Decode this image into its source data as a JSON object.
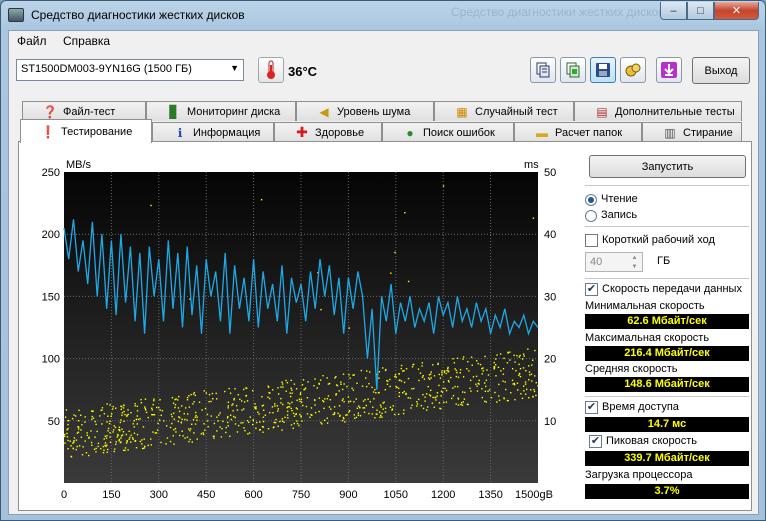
{
  "window": {
    "title": "Средство диагностики жестких дисков",
    "ghost_title": "Средство диагностики жестких дисков",
    "minimize": "–",
    "maximize": "□",
    "close": "✕"
  },
  "menu": {
    "file": "Файл",
    "help": "Справка"
  },
  "toolbar": {
    "drive": "ST1500DM003-9YN16G (1500 ГБ)",
    "temperature": "36°C",
    "exit": "Выход",
    "icons": [
      "copy-icon",
      "copy-text-icon",
      "save-icon",
      "screenshot-icon",
      "download-icon"
    ]
  },
  "tabs_row1": [
    {
      "label": "Файл-тест",
      "icon": "file-test-icon",
      "glyph": "❓"
    },
    {
      "label": "Мониторинг диска",
      "icon": "bar-chart-icon",
      "glyph": "▊"
    },
    {
      "label": "Уровень шума",
      "icon": "speaker-icon",
      "glyph": "🔊"
    },
    {
      "label": "Случайный тест",
      "icon": "random-icon",
      "glyph": "▦"
    },
    {
      "label": "Дополнительные тесты",
      "icon": "extra-tests-icon",
      "glyph": "▤"
    }
  ],
  "tabs_row2": [
    {
      "label": "Тестирование",
      "icon": "benchmark-icon",
      "glyph": "❗"
    },
    {
      "label": "Информация",
      "icon": "info-icon",
      "glyph": "ℹ"
    },
    {
      "label": "Здоровье",
      "icon": "health-cross-icon",
      "glyph": "✚"
    },
    {
      "label": "Поиск ошибок",
      "icon": "magnifier-icon",
      "glyph": "🔍"
    },
    {
      "label": "Расчет папок",
      "icon": "folder-icon",
      "glyph": "▬"
    },
    {
      "label": "Стирание",
      "icon": "trash-icon",
      "glyph": "🗑"
    }
  ],
  "controls": {
    "start": "Запустить",
    "read": "Чтение",
    "write": "Запись",
    "short_stroke": "Короткий рабочий ход",
    "short_stroke_value": "40",
    "short_stroke_unit": "ГБ",
    "transfer_rate": "Скорость передачи данных",
    "min_speed_label": "Минимальная скорость",
    "min_speed": "62.6 Мбайт/сек",
    "max_speed_label": "Максимальная скорость",
    "max_speed": "216.4 Мбайт/сек",
    "avg_speed_label": "Средняя скорость",
    "avg_speed": "148.6 Мбайт/сек",
    "access_time": "Время доступа",
    "access_time_value": "14.7 мс",
    "burst_rate": "Пиковая скорость",
    "burst_rate_value": "339.7 Мбайт/сек",
    "cpu_label": "Загрузка процессора",
    "cpu_value": "3.7%",
    "read_checked": true,
    "short_stroke_checked": false,
    "transfer_checked": true,
    "access_checked": true,
    "burst_checked": true
  },
  "chart_data": {
    "type": "line",
    "ylabel_left": "MB/s",
    "ylabel_right": "ms",
    "x_unit": "gB",
    "x_ticks": [
      "0",
      "150",
      "300",
      "450",
      "600",
      "750",
      "900",
      "1050",
      "1200",
      "1350",
      "1500gB"
    ],
    "y_left_ticks": [
      "250",
      "200",
      "150",
      "100",
      "50"
    ],
    "y_right_ticks": [
      "50",
      "40",
      "30",
      "20",
      "10"
    ],
    "xlim": [
      0,
      1500
    ],
    "ylim_left": [
      0,
      250
    ],
    "ylim_right": [
      0,
      50
    ],
    "grid": true,
    "colors": {
      "transfer": "#1ea9e6",
      "access": "#ffff00",
      "background_top": "#050505",
      "background_bottom": "#3c3c3c"
    },
    "series": [
      {
        "name": "transfer",
        "x": [
          0,
          15,
          30,
          45,
          60,
          75,
          90,
          105,
          120,
          135,
          150,
          165,
          180,
          195,
          210,
          225,
          240,
          255,
          270,
          285,
          300,
          315,
          330,
          345,
          360,
          375,
          390,
          405,
          420,
          435,
          450,
          465,
          480,
          495,
          510,
          525,
          540,
          555,
          570,
          585,
          600,
          615,
          630,
          645,
          660,
          675,
          690,
          705,
          720,
          735,
          750,
          765,
          780,
          795,
          810,
          825,
          840,
          855,
          870,
          885,
          900,
          915,
          930,
          945,
          960,
          975,
          990,
          1005,
          1020,
          1035,
          1050,
          1065,
          1080,
          1095,
          1110,
          1125,
          1140,
          1155,
          1170,
          1185,
          1200,
          1215,
          1230,
          1245,
          1260,
          1275,
          1290,
          1305,
          1320,
          1335,
          1350,
          1365,
          1380,
          1395,
          1410,
          1425,
          1440,
          1455,
          1470,
          1485,
          1500
        ],
        "values": [
          205,
          180,
          212,
          170,
          195,
          160,
          210,
          150,
          200,
          140,
          195,
          135,
          200,
          145,
          190,
          130,
          185,
          120,
          190,
          150,
          180,
          130,
          195,
          140,
          185,
          125,
          190,
          135,
          175,
          120,
          180,
          150,
          170,
          130,
          185,
          120,
          175,
          140,
          165,
          130,
          180,
          125,
          170,
          140,
          160,
          130,
          175,
          120,
          165,
          145,
          160,
          130,
          170,
          140,
          180,
          150,
          175,
          135,
          165,
          120,
          165,
          140,
          170,
          150,
          100,
          140,
          75,
          150,
          130,
          160,
          120,
          145,
          130,
          150,
          125,
          140,
          130,
          145,
          120,
          150,
          135,
          145,
          125,
          150,
          130,
          140,
          125,
          145,
          130,
          140,
          120,
          135,
          125,
          140,
          120,
          130,
          125,
          135,
          120,
          130,
          125
        ]
      },
      {
        "name": "access",
        "description_values_ms": [
          8,
          10,
          12,
          14,
          16,
          18,
          20
        ],
        "spread_start_ms": [
          4,
          12
        ],
        "spread_end_ms": [
          14,
          22
        ]
      }
    ]
  }
}
